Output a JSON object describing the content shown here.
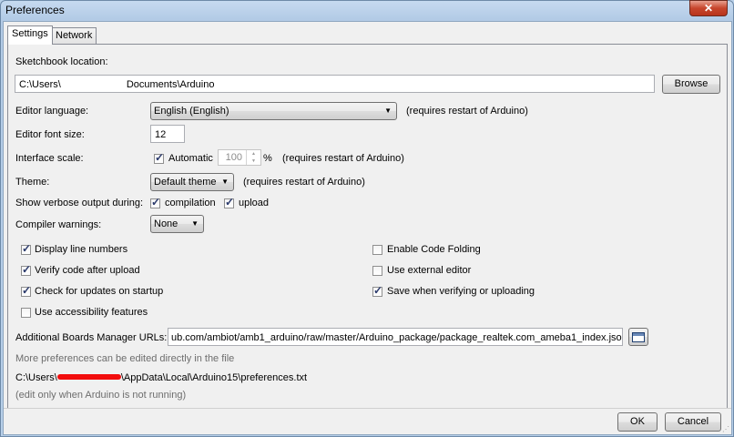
{
  "window": {
    "title": "Preferences",
    "close_glyph": "✕"
  },
  "tabs": [
    {
      "label": "Settings"
    },
    {
      "label": "Network"
    }
  ],
  "sketchbook": {
    "label": "Sketchbook location:",
    "path_prefix": "C:\\Users\\",
    "path_suffix": "Documents\\Arduino",
    "browse_label": "Browse"
  },
  "editor_language": {
    "label": "Editor language:",
    "value": "English (English)",
    "note": "(requires restart of Arduino)"
  },
  "font_size": {
    "label": "Editor font size:",
    "value": "12"
  },
  "interface_scale": {
    "label": "Interface scale:",
    "automatic_label": "Automatic",
    "automatic_checked": true,
    "value": "100",
    "unit": "%",
    "note": "(requires restart of Arduino)"
  },
  "theme": {
    "label": "Theme:",
    "value": "Default theme",
    "note": "(requires restart of Arduino)"
  },
  "verbose": {
    "label": "Show verbose output during:",
    "compilation_label": "compilation",
    "compilation_checked": true,
    "upload_label": "upload",
    "upload_checked": true
  },
  "compiler_warnings": {
    "label": "Compiler warnings:",
    "value": "None"
  },
  "options_left": [
    {
      "label": "Display line numbers",
      "checked": true
    },
    {
      "label": "Verify code after upload",
      "checked": true
    },
    {
      "label": "Check for updates on startup",
      "checked": true
    },
    {
      "label": "Use accessibility features",
      "checked": false
    }
  ],
  "options_right": [
    {
      "label": "Enable Code Folding",
      "checked": false
    },
    {
      "label": "Use external editor",
      "checked": false
    },
    {
      "label": "Save when verifying or uploading",
      "checked": true
    }
  ],
  "boards_manager": {
    "label": "Additional Boards Manager URLs:",
    "value": "ub.com/ambiot/amb1_arduino/raw/master/Arduino_package/package_realtek.com_ameba1_index.json"
  },
  "more_prefs": {
    "hint": "More preferences can be edited directly in the file",
    "path_prefix": "C:\\Users\\",
    "path_suffix": "\\AppData\\Local\\Arduino15\\preferences.txt",
    "edit_note": "(edit only when Arduino is not running)"
  },
  "footer": {
    "ok_label": "OK",
    "cancel_label": "Cancel"
  },
  "colors": {
    "redaction": "#f20d0d",
    "accent_frame": "#b9d1ea"
  }
}
